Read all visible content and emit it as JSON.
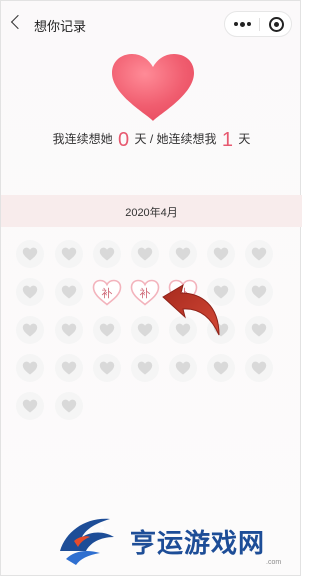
{
  "nav": {
    "title": "想你记录",
    "back_icon": "chevron-left-icon",
    "menu_icon": "more-dots-icon",
    "close_icon": "target-icon"
  },
  "hero": {
    "heart_icon": "heart-icon",
    "heart_color": "#ef5b6e",
    "text_1": "我连续想她",
    "days_me": "0",
    "text_2": "天 / 她连续想我",
    "days_her": "1",
    "text_3": "天"
  },
  "calendar": {
    "month": "2020年4月",
    "day_icon": "heart-icon",
    "makeup_label": "补",
    "accent": "#e7596f",
    "arrow_color": "#c33b2b"
  },
  "watermark": {
    "text": "亨运游戏网",
    "com": ".com",
    "color": "#1d4d97"
  }
}
